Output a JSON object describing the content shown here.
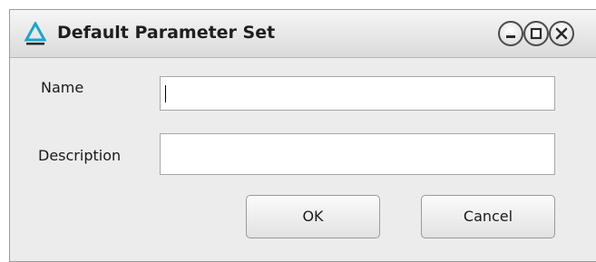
{
  "window": {
    "title": "Default Parameter Set",
    "controls": {
      "minimize_icon": "minimize-icon",
      "maximize_icon": "maximize-icon",
      "close_icon": "close-icon"
    },
    "accent_color": "#1ba6c9"
  },
  "form": {
    "name": {
      "label": "Name",
      "value": "",
      "placeholder": ""
    },
    "description": {
      "label": "Description",
      "value": "",
      "placeholder": ""
    }
  },
  "buttons": {
    "ok_label": "OK",
    "cancel_label": "Cancel"
  }
}
